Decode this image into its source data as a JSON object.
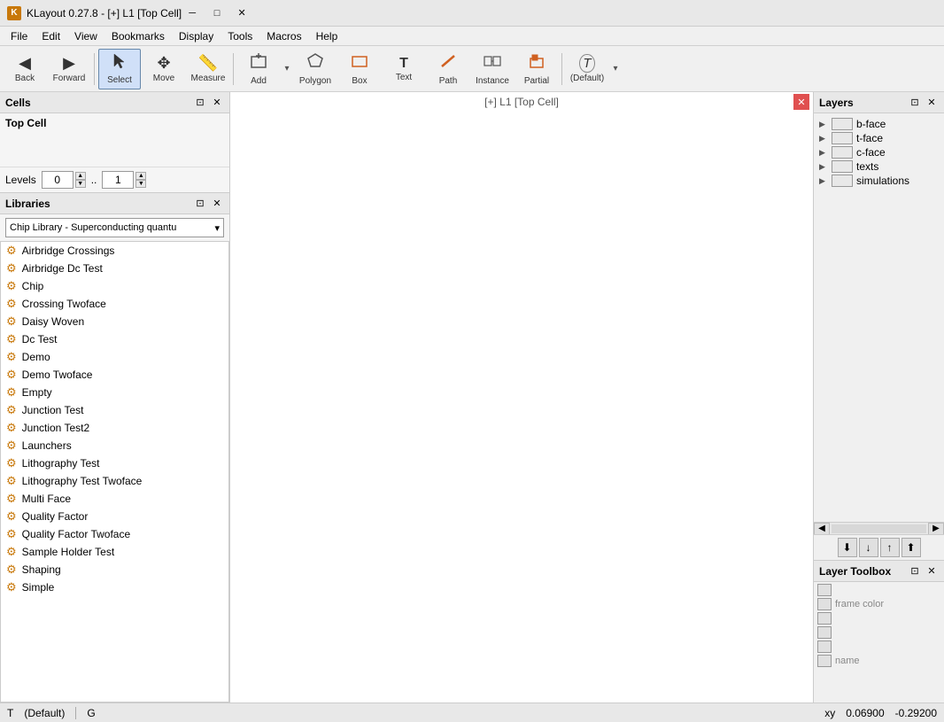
{
  "titleBar": {
    "title": "KLayout 0.27.8 - [+] L1 [Top Cell]",
    "appIcon": "K"
  },
  "menuBar": {
    "items": [
      "File",
      "Edit",
      "View",
      "Bookmarks",
      "Display",
      "Tools",
      "Macros",
      "Help"
    ]
  },
  "toolbar": {
    "buttons": [
      {
        "id": "back",
        "label": "Back",
        "icon": "◀"
      },
      {
        "id": "forward",
        "label": "Forward",
        "icon": "▶"
      },
      {
        "id": "select",
        "label": "Select",
        "icon": "↖",
        "active": true
      },
      {
        "id": "move",
        "label": "Move",
        "icon": "✥"
      },
      {
        "id": "measure",
        "label": "Measure",
        "icon": "📐"
      },
      {
        "id": "add",
        "label": "Add",
        "icon": "+"
      },
      {
        "id": "polygon",
        "label": "Polygon",
        "icon": "⬡"
      },
      {
        "id": "box",
        "label": "Box",
        "icon": "▭"
      },
      {
        "id": "text",
        "label": "Text",
        "icon": "T"
      },
      {
        "id": "path",
        "label": "Path",
        "icon": "╱"
      },
      {
        "id": "instance",
        "label": "Instance",
        "icon": "⊞"
      },
      {
        "id": "partial",
        "label": "Partial",
        "icon": "⊓"
      },
      {
        "id": "default",
        "label": "(Default)",
        "icon": "T"
      }
    ]
  },
  "cells": {
    "title": "Cells",
    "topCell": "Top Cell",
    "levels": {
      "label": "Levels",
      "from": "0",
      "to": "1"
    }
  },
  "libraries": {
    "title": "Libraries",
    "dropdown": "Chip Library - Superconducting quantu",
    "items": [
      "Airbridge Crossings",
      "Airbridge Dc Test",
      "Chip",
      "Crossing Twoface",
      "Daisy Woven",
      "Dc Test",
      "Demo",
      "Demo Twoface",
      "Empty",
      "Junction Test",
      "Junction Test2",
      "Launchers",
      "Lithography Test",
      "Lithography Test Twoface",
      "Multi Face",
      "Quality Factor",
      "Quality Factor Twoface",
      "Sample Holder Test",
      "Shaping",
      "Simple"
    ]
  },
  "canvas": {
    "title": "[+] L1 [Top Cell]"
  },
  "layers": {
    "title": "Layers",
    "items": [
      {
        "name": "b-face"
      },
      {
        "name": "t-face"
      },
      {
        "name": "c-face"
      },
      {
        "name": "texts"
      },
      {
        "name": "simulations"
      }
    ]
  },
  "layerToolbox": {
    "title": "Layer Toolbox",
    "items": [
      {
        "label": ""
      },
      {
        "label": "frame color"
      },
      {
        "label": ""
      },
      {
        "label": ""
      },
      {
        "label": ""
      },
      {
        "label": "name"
      }
    ]
  },
  "statusBar": {
    "mode": "T",
    "default": "(Default)",
    "gridLabel": "G",
    "xyLabel": "xy",
    "x": "0.06900",
    "y": "-0.29200"
  }
}
